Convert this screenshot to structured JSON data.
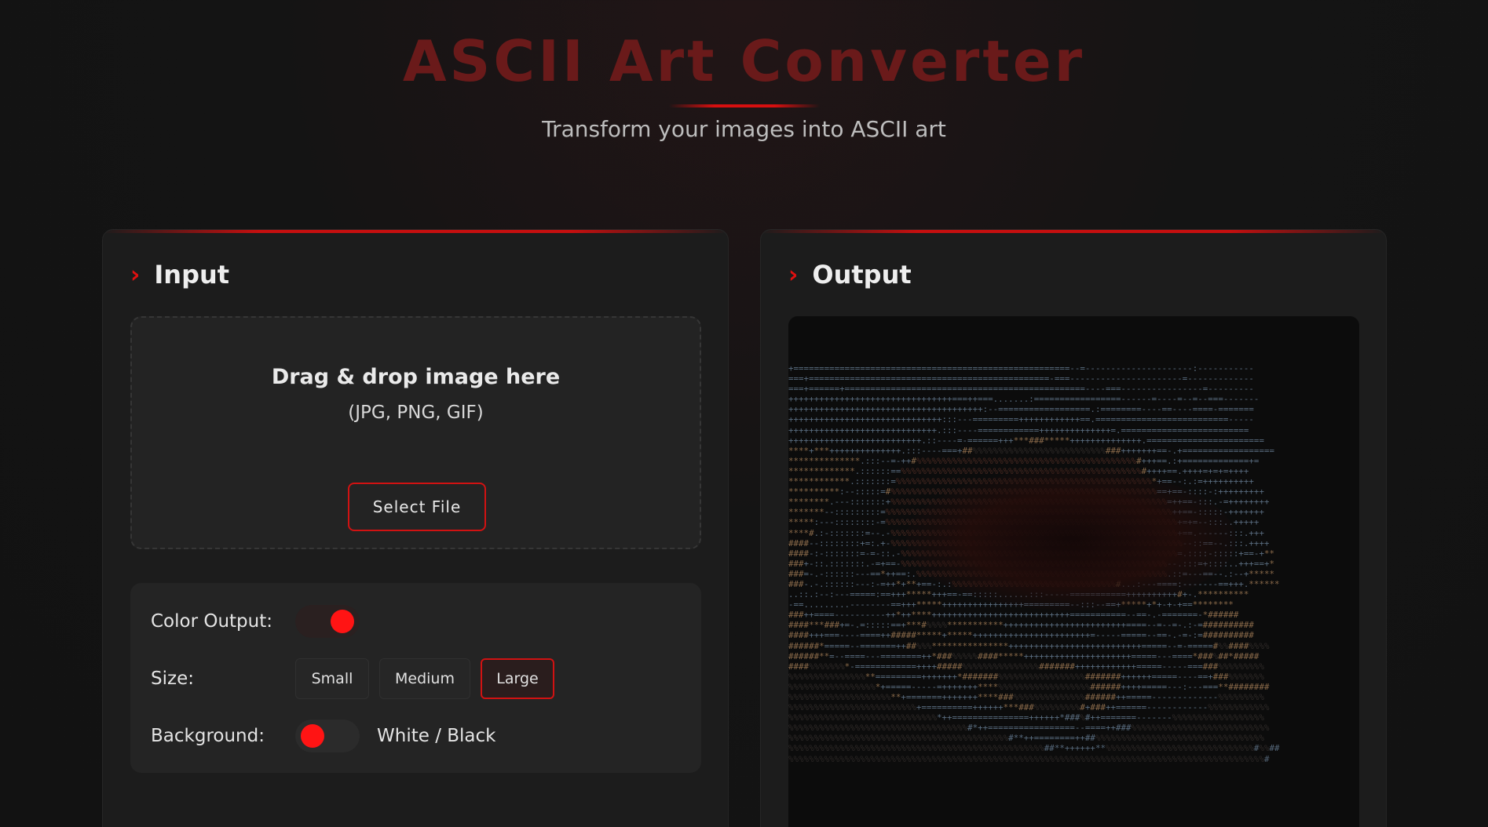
{
  "header": {
    "title": "ASCII Art Converter",
    "subtitle": "Transform your images into ASCII art"
  },
  "input_panel": {
    "title": "Input",
    "dropzone": {
      "title": "Drag & drop image here",
      "formats": "(JPG, PNG, GIF)",
      "select_button": "Select File"
    },
    "settings": {
      "color_output_label": "Color Output:",
      "color_output_enabled": true,
      "size_label": "Size:",
      "size_options": [
        "Small",
        "Medium",
        "Large"
      ],
      "size_selected": "Large",
      "background_label": "Background:",
      "background_enabled": false,
      "background_text": "White / Black"
    }
  },
  "output_panel": {
    "title": "Output",
    "ascii_lines": [
      "+======================================================--=---------------------:-----------",
      "===+===============================================-===----------------------=-------------",
      "===+======+===============================================----===----------------=---------",
      "++++++++++++++++++++++++++++++++===++===.......:=================------=----=--=--===-------",
      "++++++++++++++++++++++++++++++++++++++:--==================.:========----==----====-=======",
      "++++++++++++++++++++++++++++++:::---=========++++++++++++==.==========================-----",
      "+++++++++++++++++++++++++++++.:::----============++++++++++++++=.=========================",
      "++++++++++++++++++++++++++.::----=-======+++***###*****++++++++++++++.=======================",
      "****+***++++++++++++++.:::----===+##%%%%%%%%%%%%%%%%%%%%%%%%%%###+++++++==-.+==================",
      "**************.:::--=-++#%%%%%%%%%%%%%%%%%%%%%%%%%%%%%%%%%%%%%%%%%%%#+++==.:+=============+=",
      "*************.::::::==%%%%%%%%%%%%%%%%%%%%%%%%%%%%%%%%%%%%%%%%%%%%%%%#++++==.++++=+=+=++++",
      "************.:::::::=%%%%%%%%%%%%%%%%%%%%%%%%%%%%%%%%%%%%%%%%%%%%%%%%%%*+==--:.:=++++++++++",
      "**********:--:::::=#%%%%%%%%%%%%%%%%%%%%%%%%%%%%%%%%%%%%%%%%%%%%%%%%%%%%==+==-::::-:+++++++++",
      "********.---:::::::+%%%%%%%%%%%%%%%%%%%%%%%%%%%%%%%%%%%%%%%%%%%%%%%%%%%%%%=++==-:::.-=++++++++",
      "*******--:::::::::=%%%%%%%%%%%%%%%%%%%%%%%%%%%%%%%%%%%%%%%%%%%%%%%%%%%%%%%%++==-:::::-+++++++",
      "*****:---::::::::-=%%%%%%%%%%%%%%%%%%%%%%%%%%%%%%%%%%%%%%%%%%%%%%%%%%%%%%%%%+=+=--:::..+++++",
      "****#.:-:::::::=--.-%%%%%%%%%%%%%%%%%%%%%%%%%%%%%%%%%%%%%%%%%%%%%%%%%%%%%%%%+==.------:::.+++",
      "####--::::::::+=:.+-%%%%%%%%%%%%%%%%%%%%%%%%%%%%%%%%%%%%%%%%%%%%%%%%%%%%%%%%%--::==--.:::.++++",
      "####-:-:::::::=-=-::.-%%%%%%%%%%%%%%%%%%%%%%%%%%%%%%%%%%%%%%%%%%%%%%%%%%%%%%=.::::-:::::+==-+**",
      "###+-::.:::::::.-=+==-%%%%%%%%%%%%%%%%%%%%%%%%%%%%%%%%%%%%%%%%%%%%%%%%%%%%--.:::=+::::..+++==+*",
      "###=-.-::::::---==*++==:.%%%%%%%%%%%%%%%%%%%%%%%%%%%%%%%%%%%%%%%%%%%%%%%%%.::=---==--.:--+*****",
      "###-.-.::::::---:-=++*+**+==-:.:%%%%%%%%%%%%%%%%%%%%%%%%%%%%%%%%#...:---====:-------==+++.******",
      "..::.:--:---=====:==+++*****+++==-==:::::......:::-----===========++++++++++#+-.**********",
      "-==.........--------==+++*****++++++++++++++++=========--:::--==+*****+*+-+-+==********",
      "###++====----------++*++****+++++++++++++++++++++++++++===========--==-.-=======-*######",
      "####***###+=-.=:::::==+***#%%%%***********++++++++++++++++++++++++====--=--=-.:-=##########",
      "####+++===----====++#####*****+*****+++++++++++++++++++++++=-----=====--==-.-=-:=##########",
      "######*=====--=======++##%%%***************++++++++++++++++++++++++++=====--=-=====#%%####%%%%",
      "######**=--====---========++*###%%%%%####*****+++++++++++++++++++++=====---====*###%##*#####",
      "####%%%%%%%*-============++++#####%%%%%%%%%%%%%%%#######++++++++++++=====-----===###%%%%%%%%%",
      "%%%%%%%%%%%%%%%**=========+++++++*#######%%%%%%%%%%%%%%%%%#######++++++=====----==+###%%%%%%%",
      "%%%%%%%%%%%%%%%%%*+=====-----=+++++++****%%%%%%%%%%%%%%%%%%######++++=====---:---===**########",
      "%%%%%%%%%%%%%%%%%%%%**+=======+++++++****###%%%%%%%%%%%%%%######++=====-------------%%%%%%%%%",
      "%%%%%%%%%%%%%%%%%%%%%%%%%+==========++++++***###%%%%%%%%%#+###++======------------%%%%%%%%%%%%",
      "%%%%%%%%%%%%%%%%%%%%%%%%%%%%%*++===============++++++*###%#++=======-------%%%%%%%%%%%%%%%%%%",
      "%%%%%%%%%%%%%%%%%%%%%%%%%%%%%%%%%%%#*++=================--====++###%%%%%%%%%%%%%%%%%%%%%%%%%%%",
      "%%%%%%%%%%%%%%%%%%%%%%%%%%%%%%%%%%%%%%%%%%%#**++========++##%%%%%%%%%%%%%%%%%%%%%%%%%%%%%%%%%",
      "%%%%%%%%%%%%%%%%%%%%%%%%%%%%%%%%%%%%%%%%%%%%%%%%%%##**++++++**%%%%%%%%%%%%%%%%%%%%%%%%%%%%%#%%##",
      "%%%%%%%%%%%%%%%%%%%%%%%%%%%%%%%%%%%%%%%%%%%%%%%%%%%%%%%%%%%%%%%%%%%%%%%%%%%%%%%%%%%%%%%%%%%%%#"
    ]
  }
}
